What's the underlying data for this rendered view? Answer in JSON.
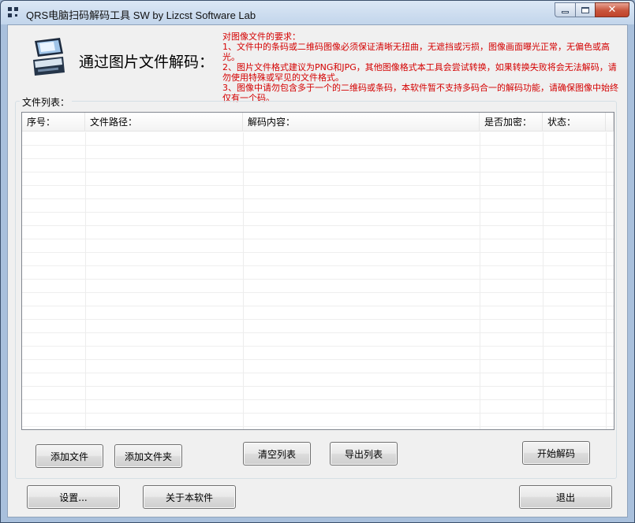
{
  "window": {
    "title": "QRS电脑扫码解码工具 SW  by Lizcst Software Lab"
  },
  "header": {
    "heading": "通过图片文件解码：",
    "icon": "scanner-icon"
  },
  "requirements": {
    "color": "#d40000",
    "lines": [
      "对图像文件的要求：",
      "1、文件中的条码或二维码图像必须保证清晰无扭曲，无遮挡或污损，图像画面曝光正常，无偏色或高光。",
      "2、图片文件格式建议为PNG和JPG，其他图像格式本工具会尝试转换，如果转换失败将会无法解码，请勿使用特殊或罕见的文件格式。",
      "3、图像中请勿包含多于一个的二维码或条码，本软件暂不支持多码合一的解码功能，请确保图像中始终仅有一个码。"
    ]
  },
  "file_list": {
    "group_label": "文件列表：",
    "columns": [
      "序号：",
      "文件路径：",
      "解码内容：",
      "是否加密：",
      "状态："
    ],
    "rows": []
  },
  "buttons": {
    "add_file": "添加文件",
    "add_folder": "添加文件夹",
    "clear_list": "清空列表",
    "export_list": "导出列表",
    "start_decode": "开始解码",
    "settings": "设置...",
    "about": "关于本软件",
    "exit": "退出"
  }
}
